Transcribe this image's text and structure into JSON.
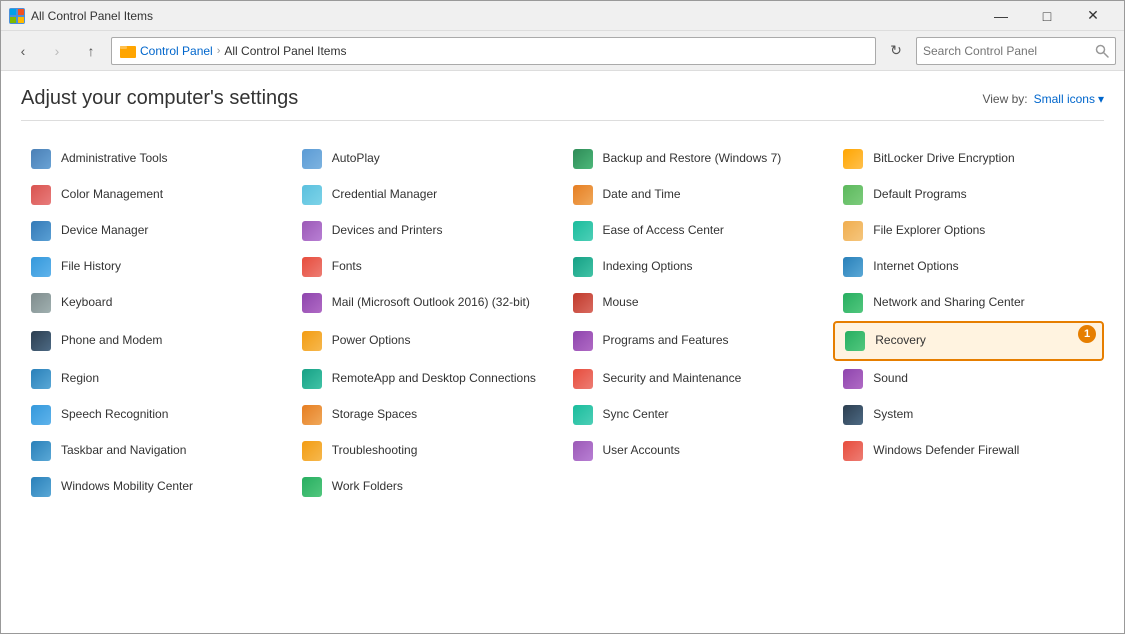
{
  "window": {
    "title": "All Control Panel Items",
    "icon": "⊞"
  },
  "titlebar": {
    "minimize": "—",
    "maximize": "□",
    "close": "✕"
  },
  "addressbar": {
    "back": "‹",
    "forward": "›",
    "up": "↑",
    "breadcrumb": [
      "Control Panel",
      "All Control Panel Items"
    ],
    "refresh": "⟳",
    "search_placeholder": "Search Control Panel"
  },
  "header": {
    "title": "Adjust your computer's settings",
    "viewby_label": "View by:",
    "viewby_value": "Small icons",
    "viewby_chevron": "▾"
  },
  "items": [
    {
      "id": "admin-tools",
      "label": "Administrative Tools",
      "icon_class": "icon-admin",
      "highlighted": false
    },
    {
      "id": "autoplay",
      "label": "AutoPlay",
      "icon_class": "icon-autoplay",
      "highlighted": false
    },
    {
      "id": "backup-restore",
      "label": "Backup and Restore (Windows 7)",
      "icon_class": "icon-backup",
      "highlighted": false
    },
    {
      "id": "bitlocker",
      "label": "BitLocker Drive Encryption",
      "icon_class": "icon-bitlocker",
      "highlighted": false
    },
    {
      "id": "color-management",
      "label": "Color Management",
      "icon_class": "icon-color",
      "highlighted": false
    },
    {
      "id": "credential-manager",
      "label": "Credential Manager",
      "icon_class": "icon-credential",
      "highlighted": false
    },
    {
      "id": "date-time",
      "label": "Date and Time",
      "icon_class": "icon-date",
      "highlighted": false
    },
    {
      "id": "default-programs",
      "label": "Default Programs",
      "icon_class": "icon-default",
      "highlighted": false
    },
    {
      "id": "device-manager",
      "label": "Device Manager",
      "icon_class": "icon-device",
      "highlighted": false
    },
    {
      "id": "devices-printers",
      "label": "Devices and Printers",
      "icon_class": "icon-devices",
      "highlighted": false
    },
    {
      "id": "ease-of-access",
      "label": "Ease of Access Center",
      "icon_class": "icon-ease",
      "highlighted": false
    },
    {
      "id": "file-explorer",
      "label": "File Explorer Options",
      "icon_class": "icon-explorer",
      "highlighted": false
    },
    {
      "id": "file-history",
      "label": "File History",
      "icon_class": "icon-file",
      "highlighted": false
    },
    {
      "id": "fonts",
      "label": "Fonts",
      "icon_class": "icon-fonts",
      "highlighted": false
    },
    {
      "id": "indexing-options",
      "label": "Indexing Options",
      "icon_class": "icon-indexing",
      "highlighted": false
    },
    {
      "id": "internet-options",
      "label": "Internet Options",
      "icon_class": "icon-internet",
      "highlighted": false
    },
    {
      "id": "keyboard",
      "label": "Keyboard",
      "icon_class": "icon-keyboard",
      "highlighted": false
    },
    {
      "id": "mail",
      "label": "Mail (Microsoft Outlook 2016) (32-bit)",
      "icon_class": "icon-mail",
      "highlighted": false
    },
    {
      "id": "mouse",
      "label": "Mouse",
      "icon_class": "icon-mouse",
      "highlighted": false
    },
    {
      "id": "network-sharing",
      "label": "Network and Sharing Center",
      "icon_class": "icon-network",
      "highlighted": false
    },
    {
      "id": "phone-modem",
      "label": "Phone and Modem",
      "icon_class": "icon-phone",
      "highlighted": false
    },
    {
      "id": "power-options",
      "label": "Power Options",
      "icon_class": "icon-power",
      "highlighted": false
    },
    {
      "id": "programs-features",
      "label": "Programs and Features",
      "icon_class": "icon-programs",
      "highlighted": false
    },
    {
      "id": "recovery",
      "label": "Recovery",
      "icon_class": "icon-recovery",
      "highlighted": true,
      "badge": "1"
    },
    {
      "id": "region",
      "label": "Region",
      "icon_class": "icon-region",
      "highlighted": false
    },
    {
      "id": "remote-app",
      "label": "RemoteApp and Desktop Connections",
      "icon_class": "icon-remote",
      "highlighted": false
    },
    {
      "id": "security-maintenance",
      "label": "Security and Maintenance",
      "icon_class": "icon-security",
      "highlighted": false
    },
    {
      "id": "sound",
      "label": "Sound",
      "icon_class": "icon-sound",
      "highlighted": false
    },
    {
      "id": "speech-recognition",
      "label": "Speech Recognition",
      "icon_class": "icon-speech",
      "highlighted": false
    },
    {
      "id": "storage-spaces",
      "label": "Storage Spaces",
      "icon_class": "icon-storage",
      "highlighted": false
    },
    {
      "id": "sync-center",
      "label": "Sync Center",
      "icon_class": "icon-sync",
      "highlighted": false
    },
    {
      "id": "system",
      "label": "System",
      "icon_class": "icon-system",
      "highlighted": false
    },
    {
      "id": "taskbar-nav",
      "label": "Taskbar and Navigation",
      "icon_class": "icon-taskbar",
      "highlighted": false
    },
    {
      "id": "troubleshooting",
      "label": "Troubleshooting",
      "icon_class": "icon-trouble",
      "highlighted": false
    },
    {
      "id": "user-accounts",
      "label": "User Accounts",
      "icon_class": "icon-user",
      "highlighted": false
    },
    {
      "id": "windows-defender",
      "label": "Windows Defender Firewall",
      "icon_class": "icon-defender",
      "highlighted": false
    },
    {
      "id": "windows-mobility",
      "label": "Windows Mobility Center",
      "icon_class": "icon-windows",
      "highlighted": false
    },
    {
      "id": "work-folders",
      "label": "Work Folders",
      "icon_class": "icon-work",
      "highlighted": false
    }
  ]
}
